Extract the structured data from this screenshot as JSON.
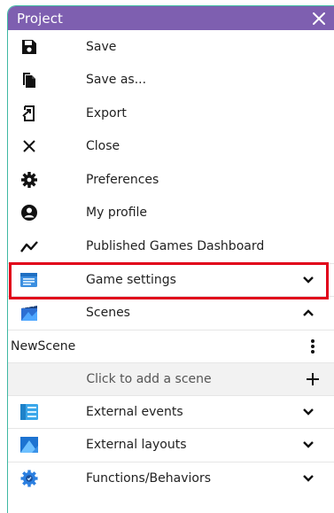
{
  "header": {
    "title": "Project",
    "close_icon": "close-icon"
  },
  "menu": {
    "save": "Save",
    "save_as": "Save as...",
    "export": "Export",
    "close": "Close",
    "preferences": "Preferences",
    "my_profile": "My profile",
    "published_games": "Published Games Dashboard"
  },
  "sections": {
    "game_settings": "Game settings",
    "scenes": "Scenes",
    "external_events": "External events",
    "external_layouts": "External layouts",
    "functions_behaviors": "Functions/Behaviors"
  },
  "scenes": {
    "items": [
      "NewScene"
    ],
    "add_label": "Click to add a scene"
  },
  "colors": {
    "header_bg": "#7e5fb0",
    "highlight": "#e1001a",
    "border_accent": "#3fb8a3"
  }
}
